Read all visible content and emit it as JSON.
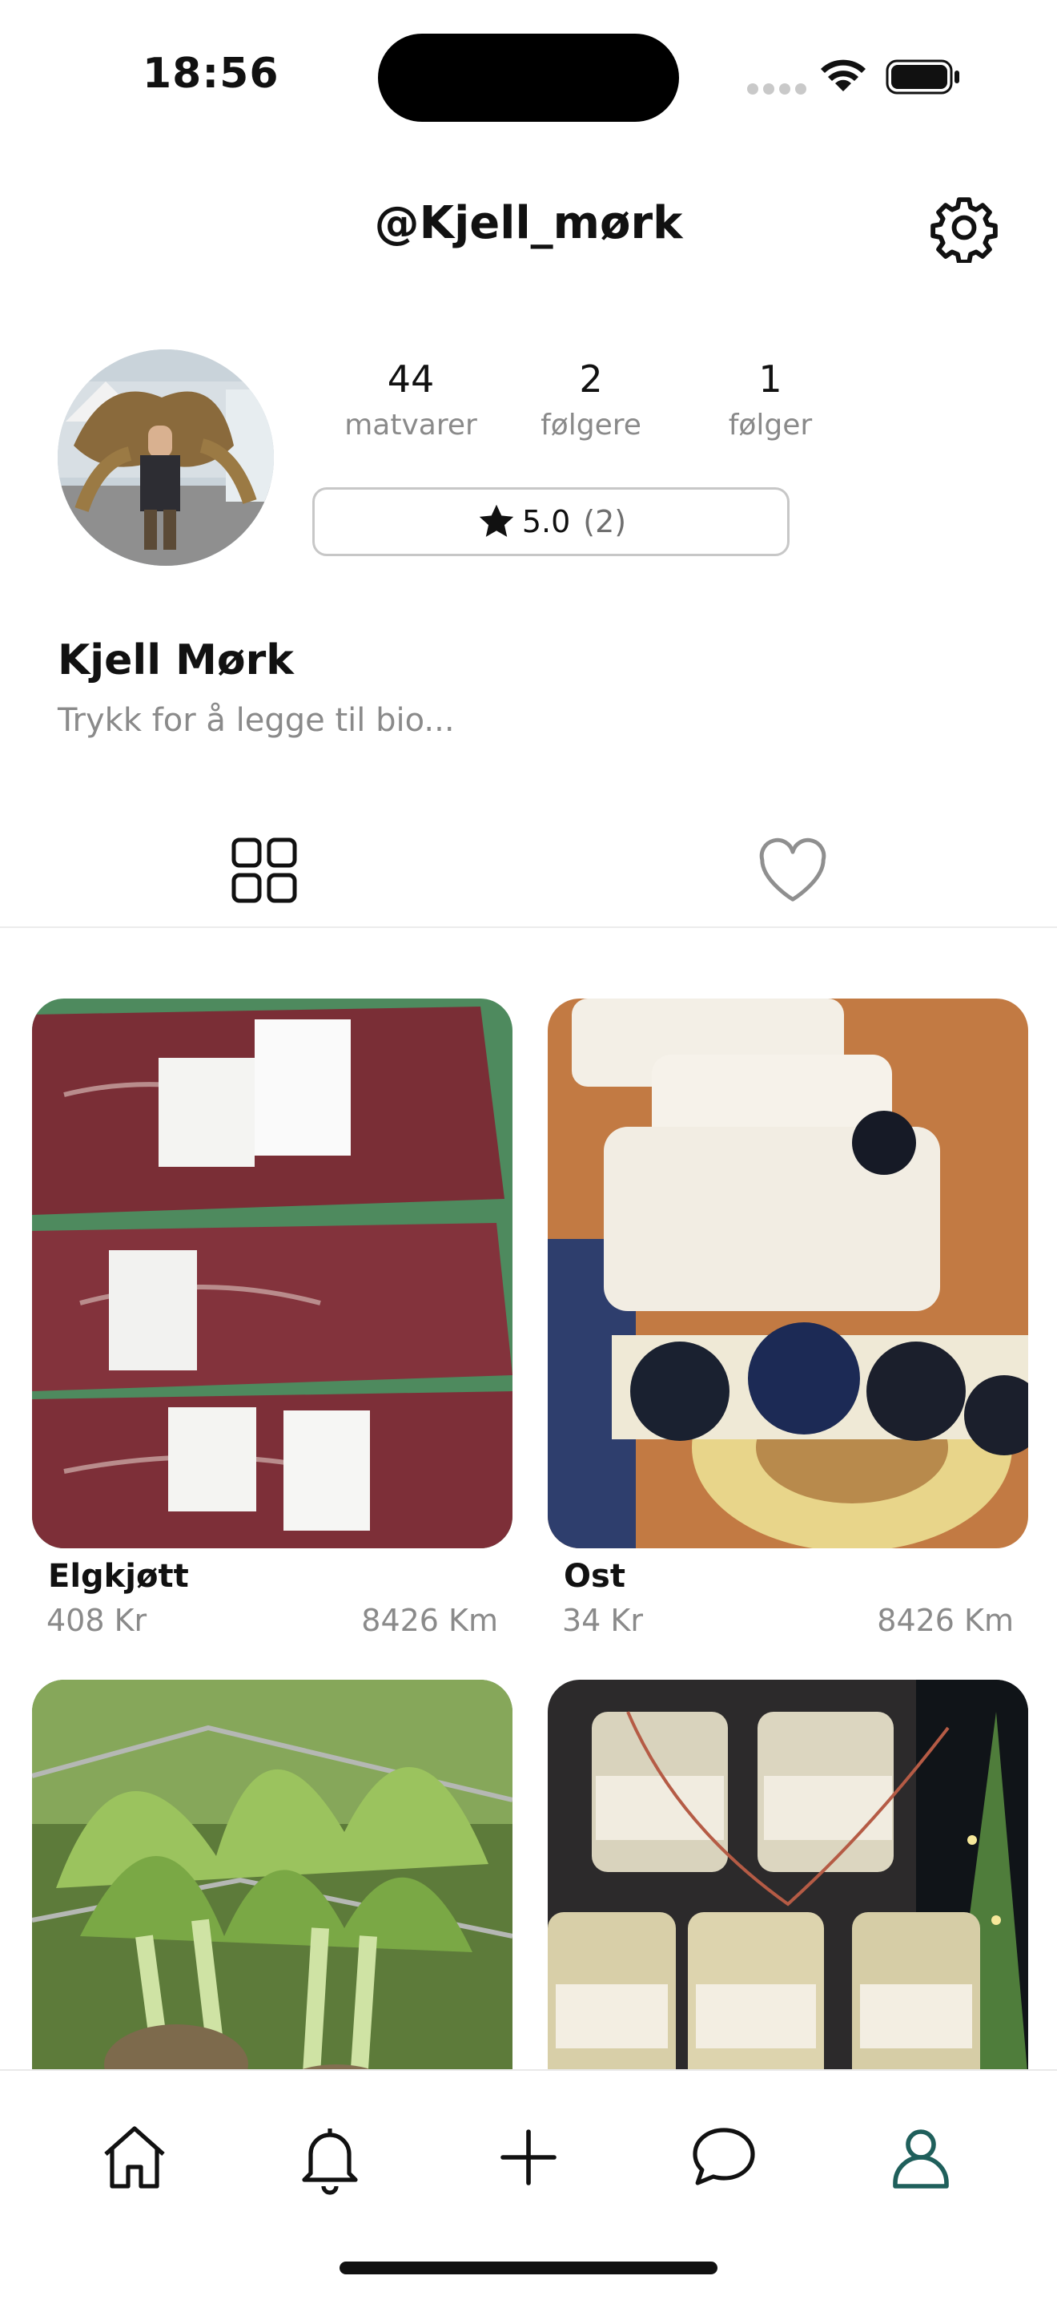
{
  "status_bar": {
    "time": "18:56"
  },
  "header": {
    "username": "@Kjell_mørk"
  },
  "profile": {
    "stats": [
      {
        "value": "44",
        "label": "matvarer"
      },
      {
        "value": "2",
        "label": "følgere"
      },
      {
        "value": "1",
        "label": "følger"
      }
    ],
    "rating": {
      "score": "5.0",
      "count": "(2)"
    },
    "name": "Kjell Mørk",
    "bio_placeholder": "Trykk for å legge til bio..."
  },
  "tabs": [
    "grid-icon",
    "heart-icon"
  ],
  "products": [
    {
      "title": "Elgkjøtt",
      "price": "408 Kr",
      "distance": "8426 Km"
    },
    {
      "title": "Ost",
      "price": "34 Kr",
      "distance": "8426 Km"
    },
    {
      "title": "",
      "price": "",
      "distance": ""
    },
    {
      "title": "",
      "price": "",
      "distance": ""
    }
  ],
  "tab_bar": {
    "items": [
      "home-icon",
      "bell-icon",
      "plus-icon",
      "chat-icon",
      "profile-icon"
    ],
    "active_color": "#1f5f5b"
  }
}
